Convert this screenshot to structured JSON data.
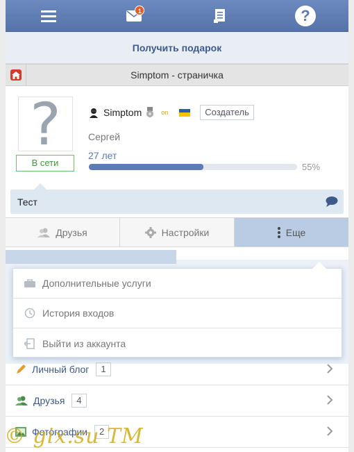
{
  "topbar": {
    "icons": [
      "menu-icon",
      "mail-icon",
      "news-icon",
      "help-icon"
    ],
    "mail_badge": "1"
  },
  "gift": {
    "label": "Получить подарок"
  },
  "titlebar": {
    "title": "Simptom - страничка"
  },
  "profile": {
    "username": "Simptom",
    "online_small": "on",
    "role": "Создатель",
    "realname": "Сергей",
    "age": "27 лет",
    "progress_value": 55,
    "progress_label": "55%",
    "online_status": "В сети"
  },
  "status": {
    "text": "Тест"
  },
  "tabs": [
    {
      "label": "Друзья"
    },
    {
      "label": "Настройки"
    },
    {
      "label": "Еще"
    }
  ],
  "dropdown": {
    "items": [
      {
        "label": "Дополнительные услуги"
      },
      {
        "label": "История входов"
      },
      {
        "label": "Выйти из аккаунта"
      }
    ]
  },
  "list": [
    {
      "label": "Личный блог",
      "count": "1"
    },
    {
      "label": "Друзья",
      "count": "4"
    },
    {
      "label": "Фотографии",
      "count": "2"
    }
  ],
  "watermark": "© gix.su TM",
  "colors": {
    "accent": "#5c7db4",
    "online": "#3f9a3f",
    "topbar": "#5d7bb0"
  }
}
